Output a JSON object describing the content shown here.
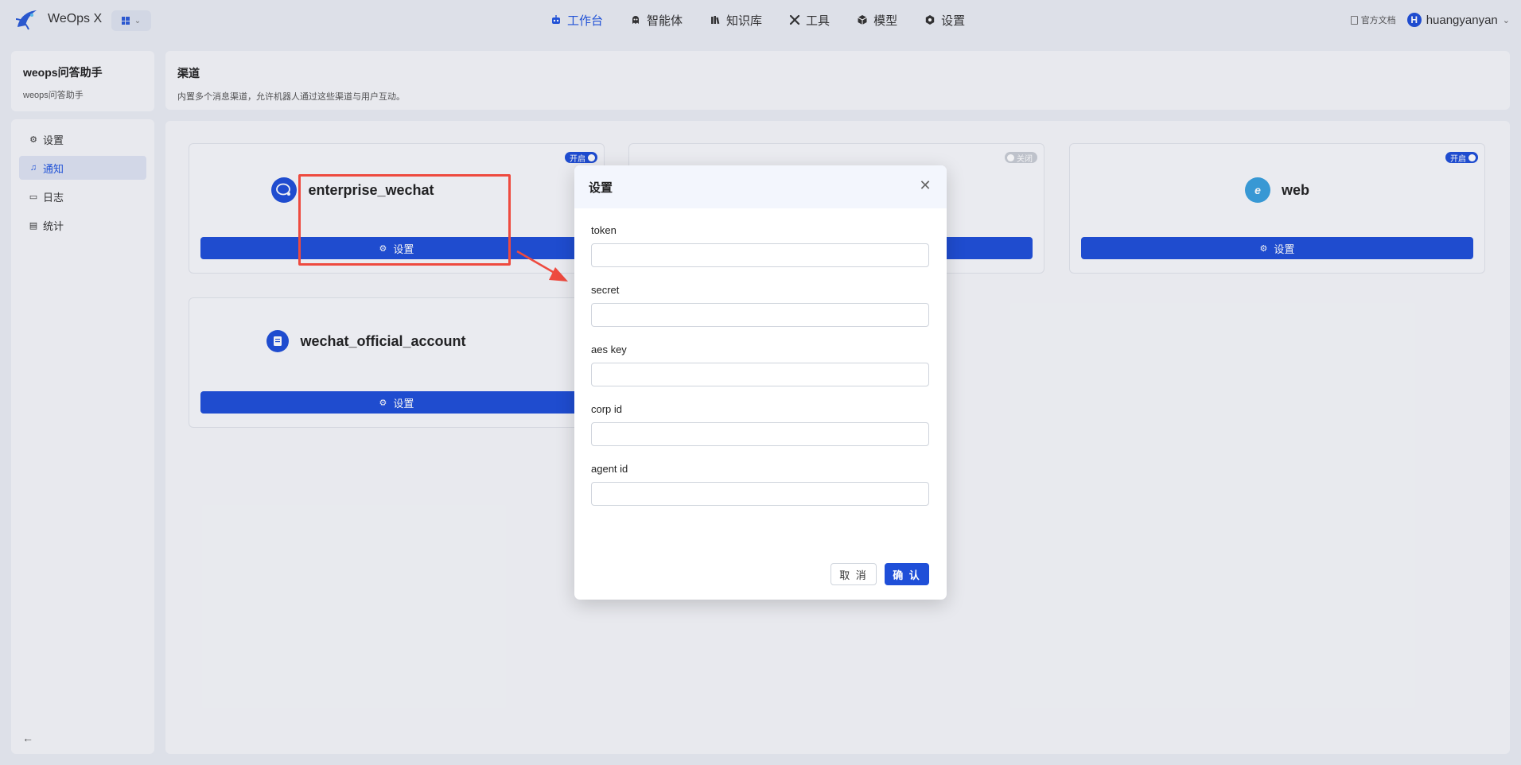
{
  "app": {
    "brand": "WeOps X",
    "switch_chevron": "⌄",
    "accent_color": "#1f4fd8",
    "highlight_color": "#ee4a3f"
  },
  "nav": {
    "items": [
      {
        "label": "工作台",
        "icon": "robot-icon",
        "active": true
      },
      {
        "label": "智能体",
        "icon": "agent-icon",
        "active": false
      },
      {
        "label": "知识库",
        "icon": "books-icon",
        "active": false
      },
      {
        "label": "工具",
        "icon": "tools-icon",
        "active": false
      },
      {
        "label": "模型",
        "icon": "cube-icon",
        "active": false
      },
      {
        "label": "设置",
        "icon": "gear-icon",
        "active": false
      }
    ]
  },
  "topright": {
    "docs": "官方文档",
    "avatar_letter": "H",
    "username": "huangyanyan"
  },
  "bot": {
    "name": "weops问答助手",
    "subtitle": "weops问答助手"
  },
  "sidebar": {
    "items": [
      {
        "label": "设置",
        "icon": "gear-icon",
        "active": false
      },
      {
        "label": "通知",
        "icon": "bell-icon",
        "active": true
      },
      {
        "label": "日志",
        "icon": "message-icon",
        "active": false
      },
      {
        "label": "统计",
        "icon": "chart-icon",
        "active": false
      }
    ],
    "collapse_icon": "arrow-left-icon"
  },
  "header": {
    "title": "渠道",
    "description": "内置多个消息渠道，允许机器人通过这些渠道与用户互动。"
  },
  "channels": [
    {
      "name": "enterprise_wechat",
      "toggle": "开启",
      "enabled": true,
      "button": "设置",
      "icon": "enterprise-wechat-icon"
    },
    {
      "name": "",
      "toggle": "关闭",
      "enabled": false,
      "button": "设置",
      "icon": ""
    },
    {
      "name": "web",
      "toggle": "开启",
      "enabled": true,
      "button": "设置",
      "icon": "web-icon"
    },
    {
      "name": "wechat_official_account",
      "toggle": "",
      "enabled": false,
      "button": "设置",
      "icon": "wechat-official-icon"
    }
  ],
  "modal": {
    "title": "设置",
    "close_icon": "close-icon",
    "fields": [
      {
        "label": "token",
        "value": ""
      },
      {
        "label": "secret",
        "value": ""
      },
      {
        "label": "aes key",
        "value": ""
      },
      {
        "label": "corp id",
        "value": ""
      },
      {
        "label": "agent id",
        "value": ""
      }
    ],
    "cancel": "取 消",
    "confirm": "确 认"
  }
}
